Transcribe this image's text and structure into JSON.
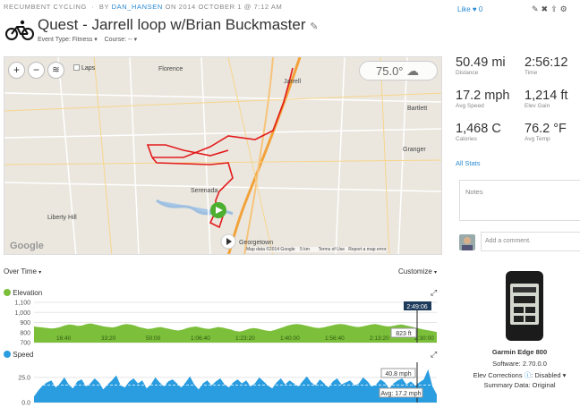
{
  "breadcrumb": {
    "category": "RECUMBENT CYCLING",
    "by": "BY",
    "user": "DAN_HANSEN",
    "date": "ON 2014 OCTOBER 1 @ 7:12 AM"
  },
  "activity": {
    "title": "Quest - Jarrell loop w/Brian Buckmaster",
    "event_type": "Event Type: Fitness ▾",
    "course": "Course: -- ▾"
  },
  "social": {
    "like": "Like",
    "like_count": "0"
  },
  "map": {
    "laps_label": "Laps",
    "temperature": "75.0°",
    "places": [
      "Florence",
      "Jarrell",
      "Bartlett",
      "Serenada",
      "Granger",
      "Liberty Hill",
      "Georgetown"
    ],
    "footer": {
      "mapdata": "Map data ©2014 Google",
      "scale": "5 km",
      "terms": "Terms of Use",
      "report": "Report a map error"
    }
  },
  "stats": [
    {
      "value": "50.49 mi",
      "label": "Distance"
    },
    {
      "value": "2:56:12",
      "label": "Time"
    },
    {
      "value": "17.2 mph",
      "label": "Avg Speed"
    },
    {
      "value": "1,214 ft",
      "label": "Elev Gain"
    },
    {
      "value": "1,468 C",
      "label": "Calories"
    },
    {
      "value": "76.2 °F",
      "label": "Avg Temp"
    }
  ],
  "all_stats": "All Stats",
  "notes_placeholder": "Notes",
  "comment_placeholder": "Add a comment.",
  "chart_controls": {
    "over_time": "Over Time",
    "customize": "Customize"
  },
  "chart_data": [
    {
      "type": "area",
      "title": "Elevation",
      "color": "#7bbf3a",
      "ylim": [
        700,
        1100
      ],
      "y_ticks": [
        "1,100",
        "1,000",
        "900",
        "800",
        "700"
      ],
      "x_ticks": [
        "16:40",
        "33:20",
        "50:00",
        "1:06:40",
        "1:23:20",
        "1:40:00",
        "1:56:40",
        "2:13:20",
        "2:30:00"
      ],
      "cursor_time": "2:49:06",
      "cursor_value": "823 ft",
      "values": [
        860,
        855,
        850,
        845,
        840,
        845,
        855,
        870,
        880,
        875,
        865,
        870,
        885,
        890,
        880,
        870,
        860,
        855,
        850,
        860,
        875,
        885,
        880,
        870,
        855,
        845,
        835,
        840,
        850,
        855,
        845,
        835,
        825,
        820,
        830,
        845,
        855,
        860,
        850,
        840,
        835,
        845,
        855,
        850,
        840,
        830,
        815,
        810,
        820,
        835,
        845,
        840,
        830,
        820,
        815,
        825,
        840,
        855,
        870,
        880,
        885,
        880,
        870,
        860,
        850,
        845,
        850,
        860,
        870,
        880,
        885,
        880,
        870,
        860,
        855,
        860,
        870,
        880,
        885,
        875,
        865,
        860,
        865,
        875,
        880,
        870,
        860,
        850,
        840,
        830,
        823,
        815,
        805
      ]
    },
    {
      "type": "area",
      "title": "Speed",
      "color": "#2a9de0",
      "ylim": [
        0,
        40
      ],
      "y_ticks": [
        "25.0",
        "0.0"
      ],
      "cursor_value": "40.8 mph",
      "avg_label": "Avg: 17.2 mph",
      "avg": 17.2,
      "values": [
        6,
        12,
        17,
        20,
        22,
        15,
        19,
        25,
        18,
        14,
        21,
        23,
        16,
        19,
        24,
        20,
        13,
        18,
        22,
        27,
        17,
        15,
        21,
        24,
        19,
        22,
        14,
        18,
        25,
        20,
        16,
        21,
        23,
        19,
        15,
        20,
        26,
        18,
        13,
        19,
        22,
        17,
        21,
        24,
        18,
        15,
        20,
        23,
        19,
        22,
        16,
        19,
        25,
        21,
        17,
        14,
        20,
        24,
        18,
        22,
        19,
        16,
        21,
        26,
        20,
        17,
        23,
        19,
        15,
        21,
        24,
        18,
        20,
        22,
        17,
        19,
        25,
        21,
        16,
        18,
        23,
        20,
        14,
        19,
        22,
        24,
        18,
        21,
        17,
        20,
        23,
        33,
        16,
        8
      ]
    }
  ],
  "device": {
    "name": "Garmin Edge 800",
    "software": "Software: 2.70.0.0",
    "elev_corrections": "Elev Corrections",
    "elev_status": ": Disabled ▾",
    "summary": "Summary Data: Original"
  }
}
